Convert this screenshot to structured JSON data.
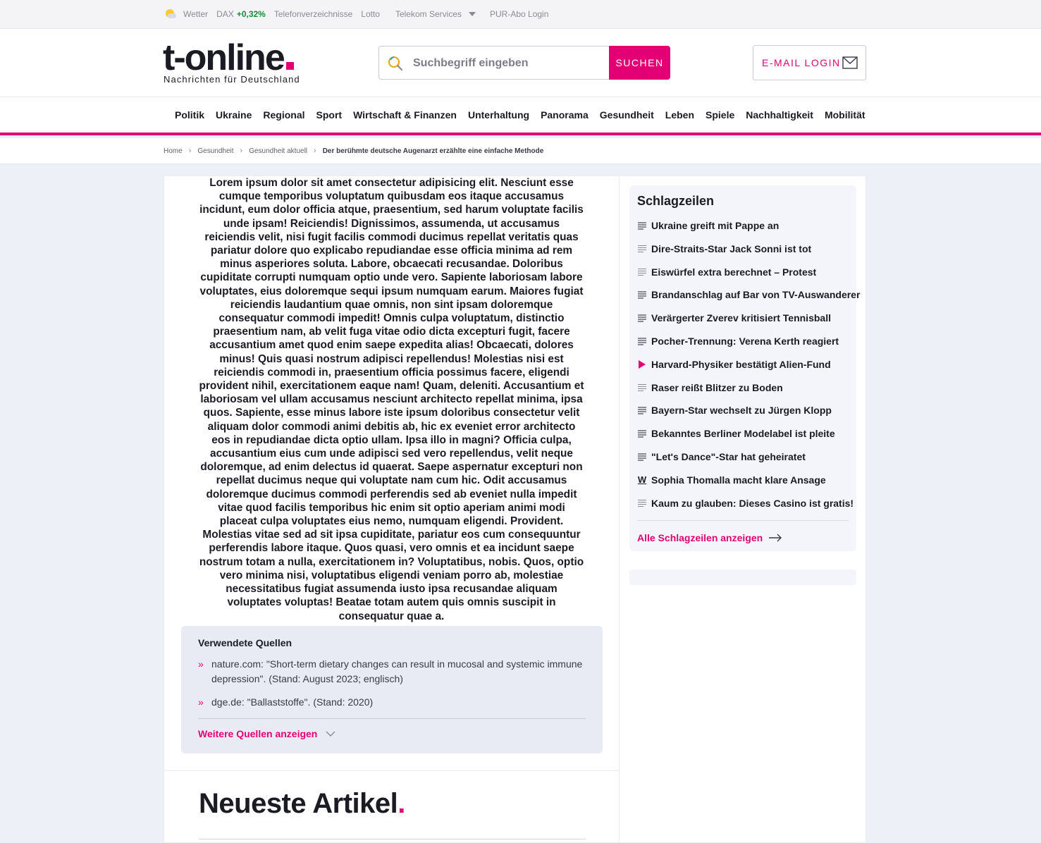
{
  "topbar": {
    "weather_label": "Wetter",
    "dax_label": "DAX",
    "dax_value": "+0,32%",
    "phone_label": "Telefonverzeichnisse",
    "lotto_label": "Lotto",
    "telekom_label": "Telekom Services",
    "pur_label": "PUR-Abo Login"
  },
  "header": {
    "logo_text": "t-online",
    "tagline": "Nachrichten für Deutschland",
    "search_placeholder": "Suchbegriff eingeben",
    "search_button": "SUCHEN",
    "mail_login": "E-MAIL LOGIN"
  },
  "nav": {
    "items": [
      "Politik",
      "Ukraine",
      "Regional",
      "Sport",
      "Wirtschaft & Finanzen",
      "Unterhaltung",
      "Panorama",
      "Gesundheit",
      "Leben",
      "Spiele",
      "Nachhaltigkeit",
      "Mobilität"
    ]
  },
  "breadcrumb": [
    "Home",
    "Gesundheit",
    "Gesundheit aktuell",
    "Der berühmte deutsche Augenarzt erzählte eine einfache Methode"
  ],
  "article": {
    "body": "Lorem ipsum dolor sit amet consectetur adipisicing elit. Nesciunt esse cumque temporibus voluptatum quibusdam eos itaque accusamus incidunt, eum dolor officia atque, praesentium, sed harum voluptate facilis unde ipsam! Reiciendis! Dignissimos, assumenda, ut accusamus reiciendis velit, nisi fugit facilis commodi ducimus repellat veritatis quas pariatur dolore quo explicabo repudiandae esse officia minima ad rem minus asperiores soluta. Labore, obcaecati recusandae. Doloribus cupiditate corrupti numquam optio unde vero. Sapiente laboriosam labore voluptates, eius doloremque sequi ipsum numquam earum. Maiores fugiat reiciendis laudantium quae omnis, non sint ipsam doloremque consequatur commodi impedit! Omnis culpa voluptatum, distinctio praesentium nam, ab velit fuga vitae odio dicta excepturi fugit, facere accusantium amet quod enim saepe expedita alias! Obcaecati, dolores minus! Quis quasi nostrum adipisci repellendus! Molestias nisi est reiciendis commodi in, praesentium officia possimus facere, eligendi provident nihil, exercitationem eaque nam! Quam, deleniti. Accusantium et laboriosam vel ullam accusamus nesciunt architecto repellat minima, ipsa quos. Sapiente, esse minus labore iste ipsum doloribus consectetur velit aliquam dolor commodi animi debitis ab, hic ex eveniet error architecto eos in repudiandae dicta optio ullam. Ipsa illo in magni? Officia culpa, accusantium eius cum unde adipisci sed vero repellendus, velit neque doloremque, ad enim delectus id quaerat. Saepe aspernatur excepturi non repellat ducimus neque qui voluptate nam cum hic. Odit accusamus doloremque ducimus commodi perferendis sed ab eveniet nulla impedit vitae quod facilis temporibus hic enim sit optio aperiam animi modi placeat culpa voluptates eius nemo, numquam eligendi. Provident. Molestias vitae sed ad sit ipsa cupiditate, pariatur eos cum consequuntur perferendis labore itaque. Quos quasi, vero omnis et ea incidunt saepe nostrum totam a nulla, exercitationem in? Voluptatibus, nobis. Quos, optio vero minima nisi, voluptatibus eligendi veniam porro ab, molestiae necessitatibus fugiat assumenda iusto ipsa recusandae aliquam voluptates voluptas! Beatae totam autem quis omnis suscipit in consequatur quae a."
  },
  "sources": {
    "title": "Verwendete Quellen",
    "items": [
      "nature.com: \"Short-term dietary changes can result in mucosal and systemic immune depression\". (Stand: August 2023; englisch)",
      "dge.de: \"Ballaststoffe\". (Stand: 2020)"
    ],
    "more_label": "Weitere Quellen anzeigen"
  },
  "newest": {
    "title": "Neueste Artikel",
    "dot": "."
  },
  "headlines": {
    "title": "Schlagzeilen",
    "items": [
      {
        "text": "Ukraine greift mit Pappe an",
        "icon": "lines-icon"
      },
      {
        "text": "Dire-Straits-Star Jack Sonni ist tot",
        "icon": "lines-icon"
      },
      {
        "text": "Eiswürfel extra berechnet – Protest",
        "icon": "lines-icon"
      },
      {
        "text": "Brandanschlag auf Bar von TV-Auswanderer",
        "icon": "lines-icon"
      },
      {
        "text": "Verärgerter Zverev kritisiert Tennisball",
        "icon": "lines-icon"
      },
      {
        "text": "Pocher-Trennung: Verena Kerth reagiert",
        "icon": "lines-icon"
      },
      {
        "text": "Harvard-Physiker bestätigt Alien-Fund",
        "icon": "play-icon"
      },
      {
        "text": "Raser reißt Blitzer zu Boden",
        "icon": "lines-icon"
      },
      {
        "text": "Bayern-Star wechselt zu Jürgen Klopp",
        "icon": "lines-icon"
      },
      {
        "text": "Bekanntes Berliner Modelabel ist pleite",
        "icon": "lines-icon"
      },
      {
        "text": "\"Let's Dance\"-Star hat geheiratet",
        "icon": "lines-icon"
      },
      {
        "text": "Sophia Thomalla macht klare Ansage",
        "icon": "w-icon"
      },
      {
        "text": "Kaum zu glauben: Dieses Casino ist gratis!",
        "icon": "lines-icon"
      }
    ],
    "all_label": "Alle Schlagzeilen anzeigen"
  },
  "colors": {
    "brand": "#e20074",
    "text": "#1b1b24",
    "background": "#eef0f8"
  }
}
